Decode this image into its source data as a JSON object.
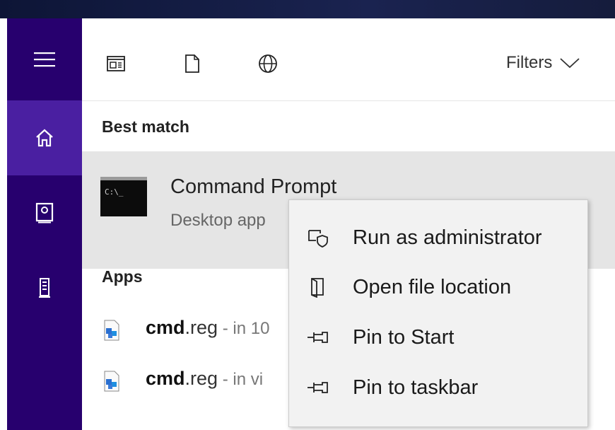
{
  "toolbar": {
    "filters_label": "Filters"
  },
  "best_match": {
    "section_title": "Best match",
    "title": "Command Prompt",
    "subtitle": "Desktop app",
    "icon_text": "C:\\_"
  },
  "apps": {
    "section_title": "Apps",
    "items": [
      {
        "name_bold": "cmd",
        "name_rest": ".reg",
        "location": " - in 10"
      },
      {
        "name_bold": "cmd",
        "name_rest": ".reg",
        "location": " - in vi"
      }
    ]
  },
  "context_menu": {
    "items": [
      {
        "label": "Run as administrator",
        "icon": "shield-window-icon"
      },
      {
        "label": "Open file location",
        "icon": "folder-door-icon"
      },
      {
        "label": "Pin to Start",
        "icon": "pin-icon"
      },
      {
        "label": "Pin to taskbar",
        "icon": "pin-icon"
      }
    ]
  },
  "colors": {
    "sidebar": "#27006e",
    "sidebar_active": "#4a1fa1",
    "selected_row": "#e5e5e5",
    "menu_bg": "#f2f2f2"
  }
}
